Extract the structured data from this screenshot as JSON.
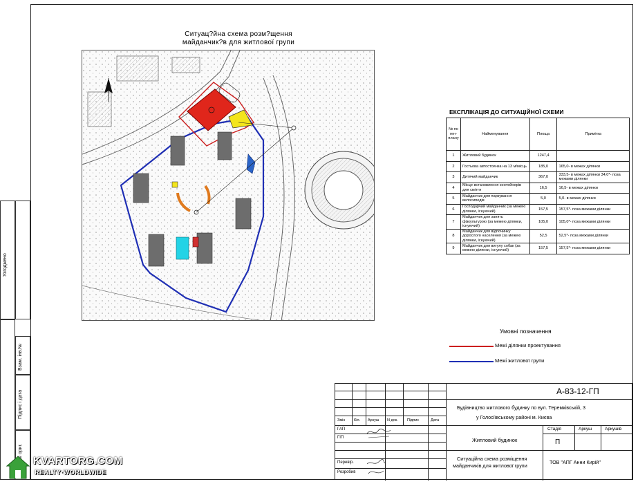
{
  "map_title": {
    "line1": "Ситуац?йна схема розм?щення",
    "line2": "майданчик?в для житлової групи"
  },
  "explication": {
    "title": "ЕКСПЛІКАЦІЯ ДО СИТУАЦІЙНОЇ СХЕМИ",
    "headers": {
      "num": "№ по ген-плану",
      "name": "Найменування",
      "area": "Площа",
      "note": "Примітка"
    },
    "rows": [
      {
        "num": "1",
        "name": "Житловий будинок",
        "area": "1247,4",
        "note": ""
      },
      {
        "num": "2",
        "name": "Гостьова автостоянка на 13 м/місць",
        "area": "185,0",
        "note": "165,0- в межах ділянки"
      },
      {
        "num": "3",
        "name": "Дитячий майданчик",
        "area": "367,0",
        "note": "333,5- в межах ділянки 34,0*- поза межами ділянки"
      },
      {
        "num": "4",
        "name": "Місце встановлення контейнерів для сміття",
        "area": "16,5",
        "note": "16,5- в межах ділянки"
      },
      {
        "num": "5",
        "name": "Майданчик для паркування велосипедів",
        "area": "5,0",
        "note": "5,0- в межах ділянки"
      },
      {
        "num": "6",
        "name": "Господарчий майданчик (за межею ділянки, існуючий)",
        "area": "157,5",
        "note": "157,5*- поза межами ділянки"
      },
      {
        "num": "7",
        "name": "Майданчик для занять фізкультурою (за межею ділянки, існуючий)",
        "area": "105,0",
        "note": "105,0*- поза межами ділянки"
      },
      {
        "num": "8",
        "name": "Майданчик для відпочинку дорослого населення (за межею ділянки, існуючий)",
        "area": "52,5",
        "note": "52,5*- поза межами ділянки"
      },
      {
        "num": "9",
        "name": "Майданчик для вигулу собак (за межею ділянки, існуючий)",
        "area": "157,5",
        "note": "157,5*- поза межами ділянки"
      }
    ]
  },
  "legend": {
    "title": "Умовні позначення",
    "items": [
      {
        "label": "Межі ділянки проектування",
        "color": "#cc1f1f"
      },
      {
        "label": "Межі житлової групи",
        "color": "#1f2fb4"
      }
    ]
  },
  "side_strip": {
    "agreed": "Узгоджено",
    "inv_no": "Інв. № ориг.",
    "signature_date": "Підпис і дата",
    "replace_inv": "Взам. інв.№"
  },
  "stamp": {
    "code": "А-83-12-ГП",
    "project_line1": "Будівництво житлового будинку по вул. Теремківській, 3",
    "project_line2": "у Голосіївському районі м. Києва",
    "cols": [
      "Змін",
      "Кіл.",
      "Аркуш",
      "N док.",
      "Підпис",
      "Дата"
    ],
    "roles": [
      "ГАП",
      "ГІП",
      "Перевір.",
      "Розробив"
    ],
    "object": "Житловий будинок",
    "stage_h": "Стадія",
    "sheet_h": "Аркуш",
    "sheets_h": "Аркушів",
    "stage": "П",
    "drawing_line1": "Ситуаційна схема розміщення",
    "drawing_line2": "майданчиків для житлової групи",
    "company": "ТОВ \"АПГ Анни Кирій\""
  },
  "watermark": {
    "line1": "KVARTORG.COM",
    "line2": "REALTY·WORLDWIDE"
  },
  "colors": {
    "site_fill": "#e0261b",
    "playground_yellow": "#f3e51c",
    "parking_blue": "#2a64c8",
    "cyan_pad": "#22d3e6",
    "orange_arc": "#e07a1e",
    "group_boundary": "#1f2fb4",
    "site_boundary": "#cc1f1f",
    "building": "#6d6d6d"
  }
}
